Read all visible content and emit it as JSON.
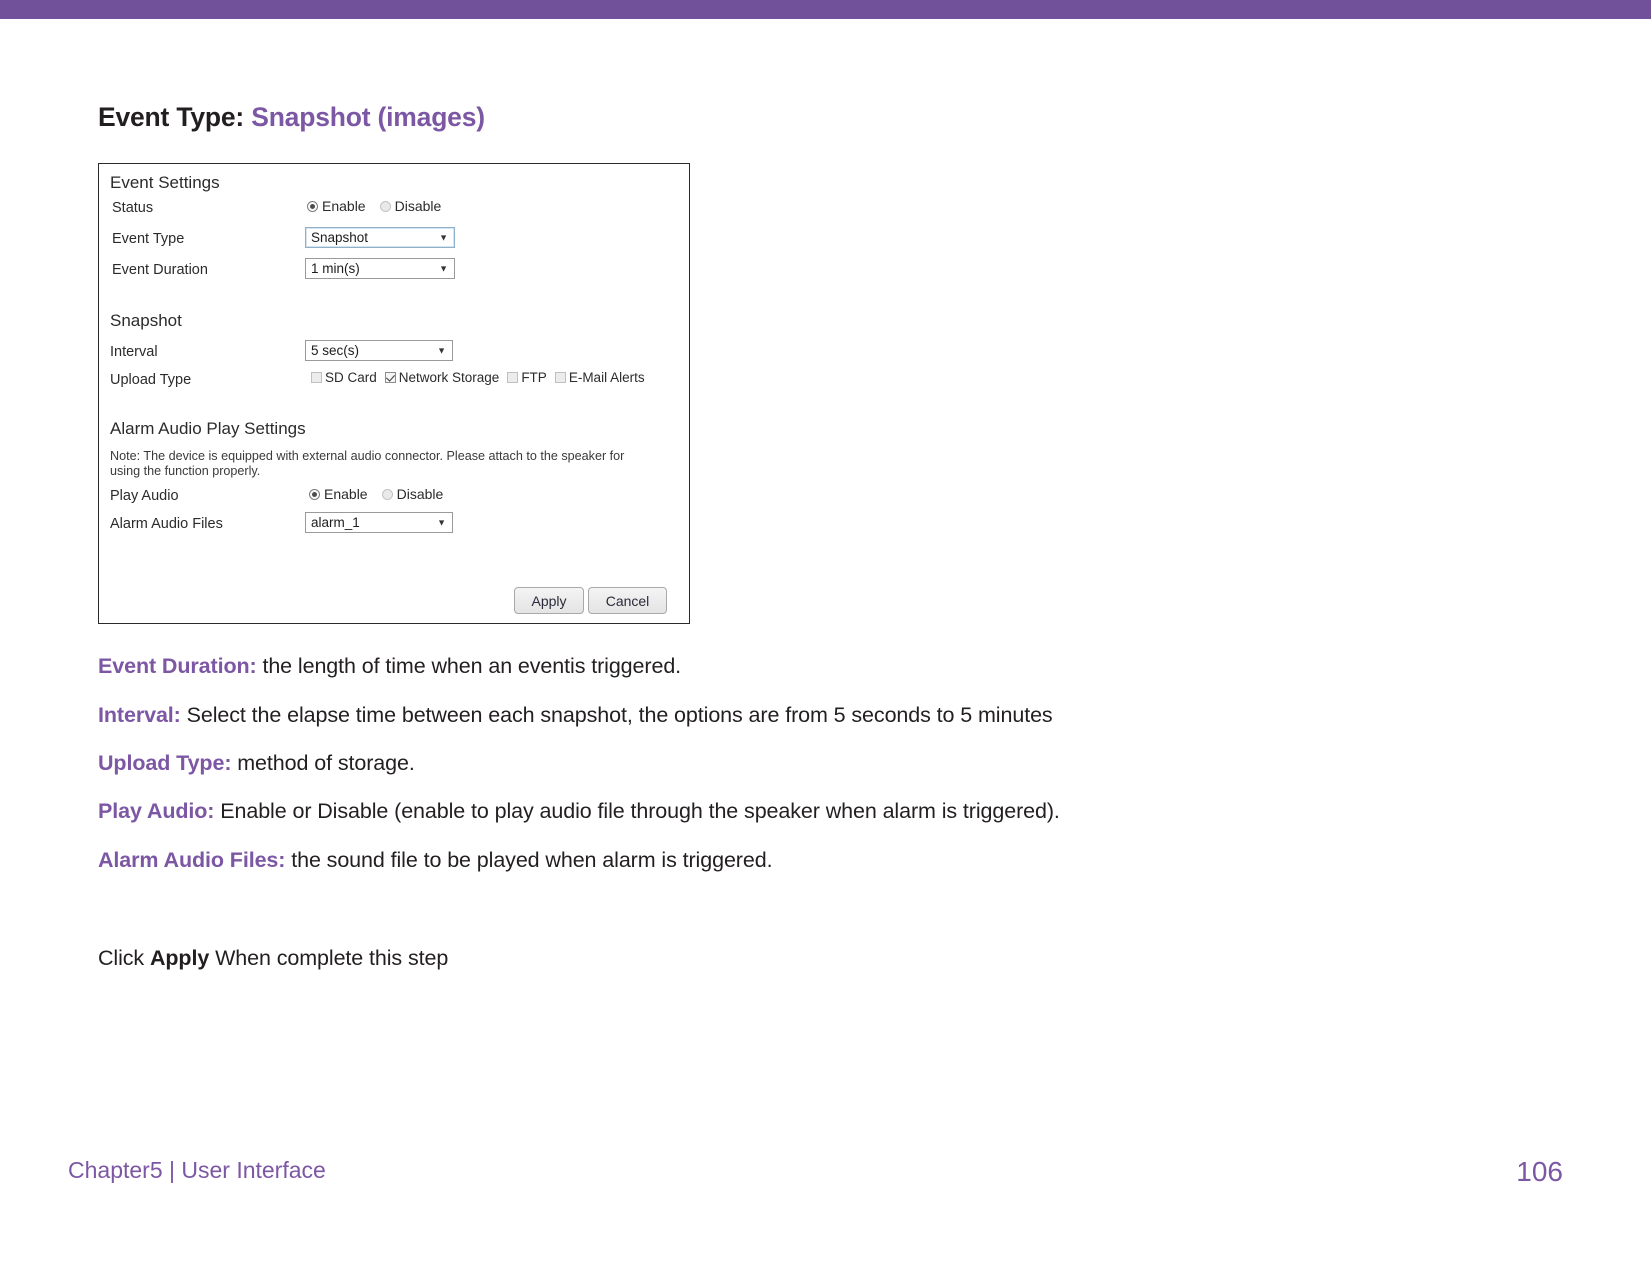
{
  "theme": {
    "accent": "#7c57a4",
    "top_bar": "#71529a",
    "text": "#231f20"
  },
  "heading": {
    "label": "Event Type:",
    "value": "Snapshot (images)"
  },
  "panel": {
    "sections": {
      "event_settings_title": "Event Settings",
      "snapshot_title": "Snapshot",
      "alarm_audio_title": "Alarm Audio Play Settings"
    },
    "note": "Note: The device is equipped with external audio connector. Please attach to the speaker for using the function properly.",
    "fields": {
      "status_label": "Status",
      "status_enable": "Enable",
      "status_disable": "Disable",
      "status_selected": "Enable",
      "event_type_label": "Event Type",
      "event_type_value": "Snapshot",
      "event_duration_label": "Event Duration",
      "event_duration_value": "1 min(s)",
      "interval_label": "Interval",
      "interval_value": "5 sec(s)",
      "upload_type_label": "Upload Type",
      "play_audio_label": "Play Audio",
      "play_audio_enable": "Enable",
      "play_audio_disable": "Disable",
      "play_audio_selected": "Enable",
      "alarm_audio_files_label": "Alarm Audio Files",
      "alarm_audio_files_value": "alarm_1"
    },
    "upload_types": [
      {
        "label": "SD Card",
        "checked": false
      },
      {
        "label": "Network Storage",
        "checked": true
      },
      {
        "label": "FTP",
        "checked": false
      },
      {
        "label": "E-Mail Alerts",
        "checked": false
      }
    ],
    "buttons": {
      "apply": "Apply",
      "cancel": "Cancel"
    }
  },
  "descriptions": [
    {
      "key": "Event Duration:",
      "text": " the length of time when an eventis triggered."
    },
    {
      "key": "Interval:",
      "text": " Select the elapse time between each snapshot, the options are from 5 seconds to 5 minutes"
    },
    {
      "key": "Upload Type:",
      "text": " method of storage."
    },
    {
      "key": "Play Audio:",
      "text": " Enable or Disable (enable to play audio file through the speaker when alarm is triggered)."
    },
    {
      "key": "Alarm Audio Files:",
      "text": " the sound file to be played when alarm is triggered."
    }
  ],
  "closing": {
    "prefix": "Click ",
    "bold": "Apply",
    "suffix": " When complete this step"
  },
  "footer": {
    "chapter": "Chapter5  |  User Interface",
    "page_number": "106"
  }
}
